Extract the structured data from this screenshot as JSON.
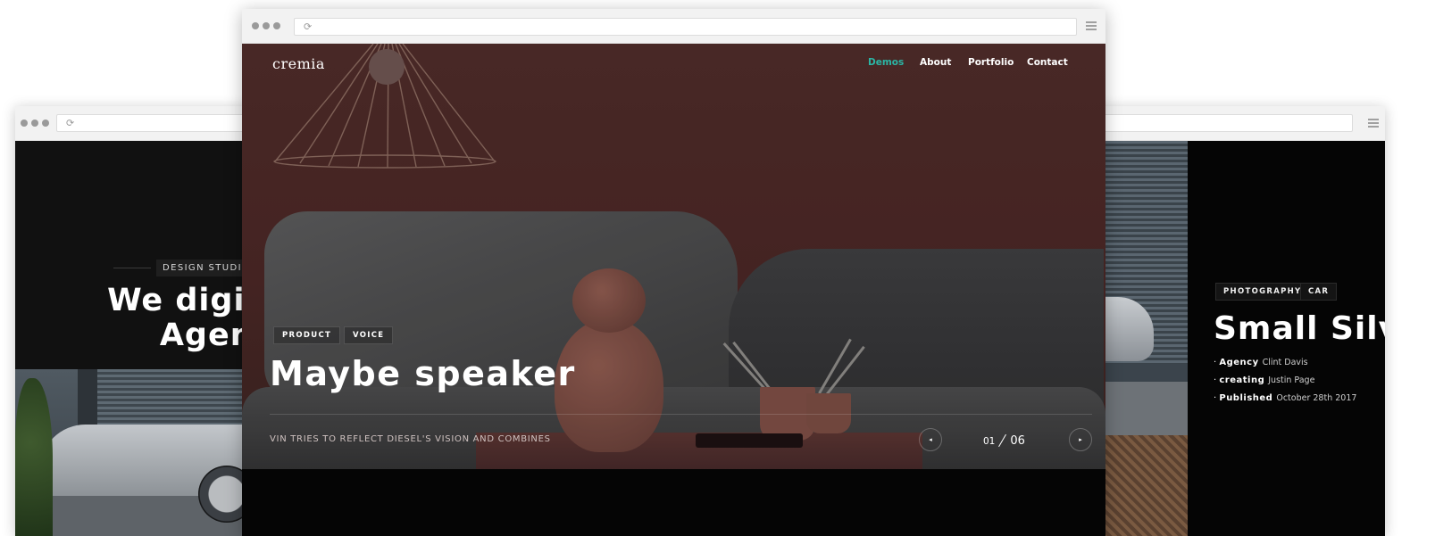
{
  "left_window": {
    "tag": "DESIGN STUDIO",
    "title_line1": "We digital Cr",
    "title_line2": "Agency"
  },
  "center_window": {
    "logo_text": "cremia",
    "nav": [
      {
        "label": "Demos",
        "active": true
      },
      {
        "label": "About",
        "active": false
      },
      {
        "label": "Portfolio",
        "active": false
      },
      {
        "label": "Contact",
        "active": false
      }
    ],
    "tags": [
      "PRODUCT",
      "VOICE"
    ],
    "title": "Maybe speaker",
    "subtitle": "VIN TRIES TO REFLECT DIESEL'S VISION AND COMBINES",
    "slider": {
      "current": "01",
      "total": "06",
      "prev_icon": "◂",
      "next_icon": "▸"
    }
  },
  "right_window": {
    "tags": [
      "PHOTOGRAPHY",
      "CAR"
    ],
    "title": "Small Silver",
    "meta": [
      {
        "key": "Agency",
        "value": "Clint Davis"
      },
      {
        "key": "creating",
        "value": "Justin Page"
      },
      {
        "key": "Published",
        "value": "October 28th 2017"
      }
    ]
  },
  "browser": {
    "reload_icon": "⟳"
  },
  "colors": {
    "accent": "#2bb5a4",
    "hero_bg": "#4a2725",
    "dark_bg": "#050505"
  }
}
